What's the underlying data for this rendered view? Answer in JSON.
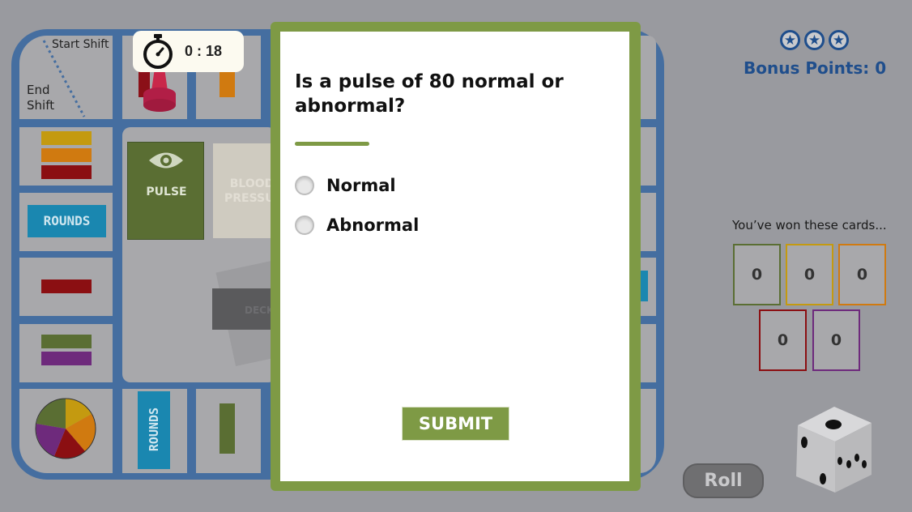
{
  "board": {
    "start_shift_label": "Start Shift",
    "end_shift_line1": "End",
    "end_shift_line2": "Shift",
    "rounds_label_left": "ROUNDS",
    "rounds_label_bottom": "ROUNDS",
    "pulse_card_label": "PULSE",
    "bp_card_line1": "BLOOD",
    "bp_card_line2": "PRESSURE",
    "deck_label": "DECK"
  },
  "timer": {
    "icon": "stopwatch-icon",
    "value": "0 : 18"
  },
  "question_modal": {
    "question": "Is a pulse of 80 normal or abnormal?",
    "options": [
      {
        "label": "Normal",
        "selected": false
      },
      {
        "label": "Abnormal",
        "selected": false
      }
    ],
    "submit_label": "SUBMIT"
  },
  "bonus": {
    "stars": 3,
    "label": "Bonus Points: 0"
  },
  "won_cards": {
    "label": "You’ve won these cards...",
    "cards": [
      {
        "value": "0",
        "color": "#5a6e33"
      },
      {
        "value": "0",
        "color": "#c49a10"
      },
      {
        "value": "0",
        "color": "#d07a10"
      },
      {
        "value": "0",
        "color": "#8b0f12"
      },
      {
        "value": "0",
        "color": "#6e2a7c"
      }
    ]
  },
  "roll_label": "Roll",
  "colors": {
    "accent": "#7e9a45",
    "board": "#456ea0",
    "bonus": "#1f4e8c"
  }
}
